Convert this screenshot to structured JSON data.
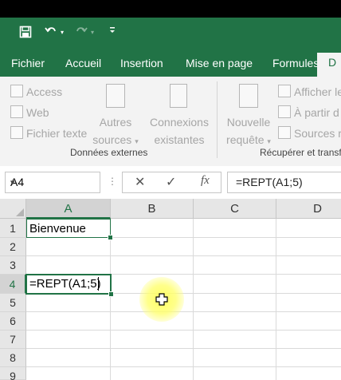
{
  "quick_access": {
    "icons": [
      "save-icon",
      "undo-icon",
      "redo-icon",
      "customize-icon"
    ]
  },
  "tabs": [
    {
      "label": "Fichier"
    },
    {
      "label": "Accueil"
    },
    {
      "label": "Insertion"
    },
    {
      "label": "Mise en page"
    },
    {
      "label": "Formules"
    },
    {
      "label": "D"
    }
  ],
  "ribbon": {
    "external_data": {
      "items": [
        "Access",
        "Web",
        "Fichier texte"
      ],
      "other_sources": [
        "Autres",
        "sources"
      ],
      "connections": [
        "Connexions",
        "existantes"
      ],
      "group_label": "Données externes"
    },
    "get_transform": {
      "new_query": [
        "Nouvelle",
        "requête"
      ],
      "items": [
        "Afficher le",
        "À partir d",
        "Sources re"
      ],
      "group_label": "Récupérer et transfo"
    }
  },
  "formula_bar": {
    "name_box": "A4",
    "fx_label": "fx",
    "formula": "=REPT(A1;5)"
  },
  "sheet": {
    "columns": [
      "A",
      "B",
      "C",
      "D"
    ],
    "rows": [
      "1",
      "2",
      "3",
      "4",
      "5",
      "6",
      "7",
      "8",
      "9"
    ],
    "selected_cell": "A4",
    "cells": {
      "A1": "Bienvenue",
      "A4": "=REPT(A1;5)"
    }
  },
  "colors": {
    "accent": "#217346",
    "cursor_highlight": "#ffff66"
  }
}
